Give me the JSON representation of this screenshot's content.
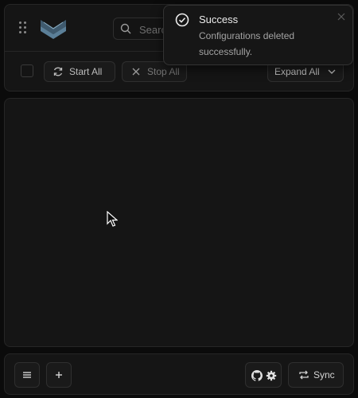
{
  "toolbar": {
    "search_placeholder": "Search",
    "start_all": "Start All",
    "stop_all": "Stop All",
    "expand_all": "Expand All"
  },
  "toast": {
    "title": "Success",
    "message": "Configurations deleted successfully."
  },
  "footer": {
    "sync_label": "Sync"
  },
  "icons": {
    "grip": "grip-dots-icon",
    "logo": "chevron-logo-icon",
    "search": "search-icon",
    "start": "refresh-icon",
    "stop": "close-icon",
    "expand": "chevron-down-icon",
    "toast": "check-circle-icon",
    "menu": "menu-icon",
    "add": "plus-icon",
    "github": "github-icon",
    "settings": "gear-icon",
    "sync": "sync-icon"
  },
  "colors": {
    "background": "#0b0b0b",
    "panel": "#151515",
    "logo": "#5b7f98"
  }
}
